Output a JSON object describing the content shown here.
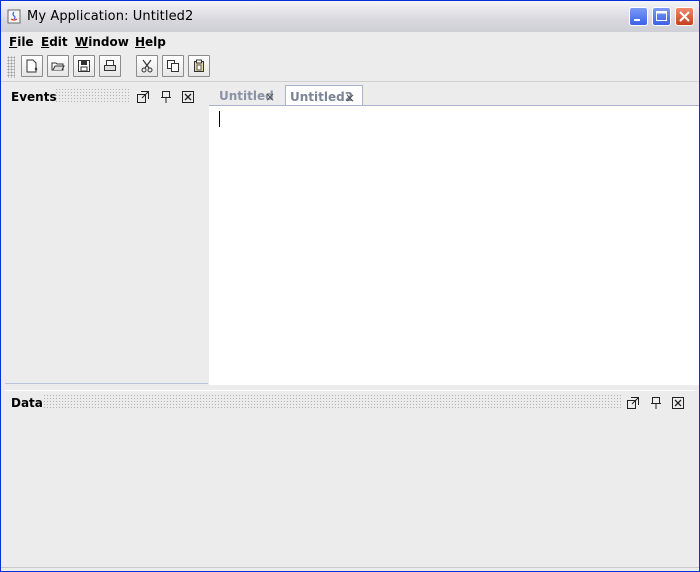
{
  "window": {
    "title": "My Application: Untitled2",
    "controls": [
      "minimize",
      "maximize",
      "close"
    ]
  },
  "menubar": {
    "items": [
      {
        "label": "File"
      },
      {
        "label": "Edit"
      },
      {
        "label": "Window"
      },
      {
        "label": "Help"
      }
    ]
  },
  "toolbar": {
    "buttons": [
      {
        "icon": "new-document-icon"
      },
      {
        "icon": "open-folder-icon"
      },
      {
        "icon": "save-icon"
      },
      {
        "icon": "print-icon"
      },
      {
        "icon": "cut-icon"
      },
      {
        "icon": "copy-icon"
      },
      {
        "icon": "paste-icon"
      }
    ]
  },
  "events_panel": {
    "title": "Events",
    "icons": [
      "restore-icon",
      "pin-icon",
      "close-icon"
    ]
  },
  "editor": {
    "tabs": [
      {
        "label": "Untitled",
        "close": "×",
        "active": false
      },
      {
        "label": "Untitled2",
        "close": "×",
        "active": true
      }
    ]
  },
  "data_panel": {
    "title": "Data",
    "icons": [
      "restore-icon",
      "pin-icon",
      "close-icon"
    ]
  },
  "colors": {
    "titlebar": "#d8d8de",
    "accent_blue": "#3a62e6",
    "close_red": "#c8401d",
    "panel_bg": "#ececec"
  }
}
